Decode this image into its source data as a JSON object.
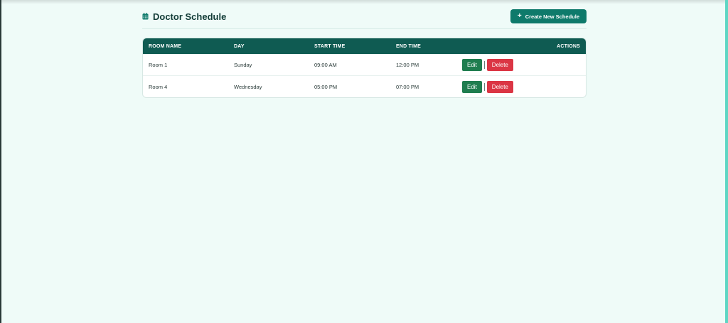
{
  "header": {
    "title": "Doctor Schedule",
    "title_icon": "calendar-icon",
    "create_button_label": "Create New Schedule",
    "create_button_icon": "plus-icon"
  },
  "table": {
    "columns": [
      "ROOM NAME",
      "DAY",
      "START TIME",
      "END TIME",
      "ACTIONS"
    ],
    "rows": [
      {
        "room": "Room 1",
        "day": "Sunday",
        "start": "09:00 AM",
        "end": "12:00 PM"
      },
      {
        "room": "Room 4",
        "day": "Wednesday",
        "start": "05:00 PM",
        "end": "07:00 PM"
      }
    ],
    "edit_label": "Edit",
    "delete_label": "Delete"
  },
  "colors": {
    "accent": "#0e7a6b",
    "header_bg": "#0f5b52",
    "edit": "#1f7d4f",
    "delete": "#db3544",
    "page_bg": "#effbf8"
  }
}
